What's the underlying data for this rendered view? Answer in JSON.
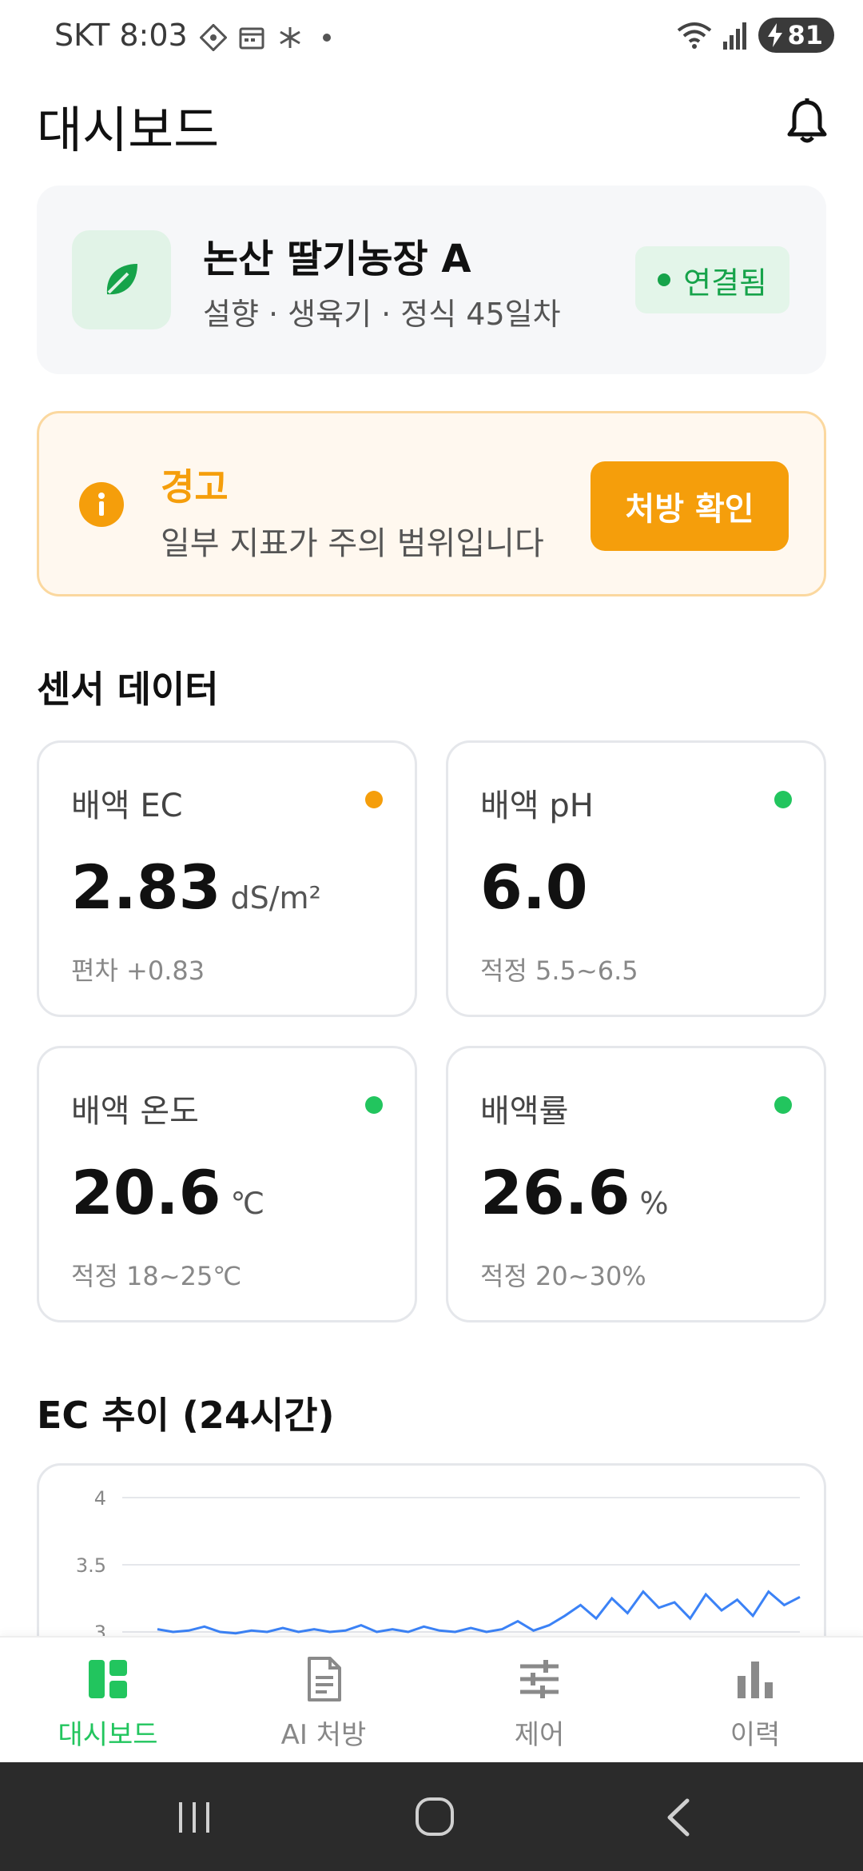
{
  "status_bar": {
    "time": "SKT 8:03",
    "battery": "81"
  },
  "header": {
    "title": "대시보드"
  },
  "farm": {
    "name": "논산 딸기농장 A",
    "subtitle": "설향 · 생육기 · 정식 45일차",
    "status": "연결됨"
  },
  "alert": {
    "title": "경고",
    "message": "일부 지표가 주의 범위입니다",
    "button": "처방 확인"
  },
  "sensors": {
    "title": "센서 데이터",
    "items": [
      {
        "label": "배액 EC",
        "value": "2.83",
        "unit": "dS/m²",
        "foot": "편차 +0.83",
        "status_color": "#f59e0b"
      },
      {
        "label": "배액 pH",
        "value": "6.0",
        "unit": "",
        "foot": "적정 5.5~6.5",
        "status_color": "#22c55e"
      },
      {
        "label": "배액 온도",
        "value": "20.6",
        "unit": "℃",
        "foot": "적정 18~25℃",
        "status_color": "#22c55e"
      },
      {
        "label": "배액률",
        "value": "26.6",
        "unit": "%",
        "foot": "적정 20~30%",
        "status_color": "#22c55e"
      }
    ]
  },
  "chart_section": {
    "title": "EC 추이 (24시간)"
  },
  "chart_data": {
    "type": "line",
    "title": "EC 추이 (24시간)",
    "y_ticks": [
      "4",
      "3.5",
      "3"
    ],
    "ylim": [
      3,
      4
    ],
    "grid": true,
    "series": [
      {
        "color": "#3b82f6",
        "values": [
          3.02,
          3.0,
          3.01,
          3.04,
          3.0,
          2.99,
          3.01,
          3.0,
          3.03,
          3.0,
          3.02,
          3.0,
          3.01,
          3.05,
          3.0,
          3.02,
          3.0,
          3.04,
          3.01,
          3.0,
          3.03,
          3.0,
          3.02,
          3.08,
          3.01,
          3.05,
          3.12,
          3.2,
          3.1,
          3.25,
          3.14,
          3.3,
          3.18,
          3.22,
          3.1,
          3.28,
          3.16,
          3.24,
          3.12,
          3.3,
          3.2,
          3.26
        ]
      }
    ]
  },
  "bottom_nav": {
    "items": [
      {
        "label": "대시보드",
        "icon": "dashboard-icon"
      },
      {
        "label": "AI 처방",
        "icon": "document-icon"
      },
      {
        "label": "제어",
        "icon": "sliders-icon"
      },
      {
        "label": "이력",
        "icon": "bar-chart-icon"
      }
    ]
  },
  "colors": {
    "accent_green": "#22c55e",
    "warning_orange": "#f59e0b",
    "chart_line": "#3b82f6"
  }
}
